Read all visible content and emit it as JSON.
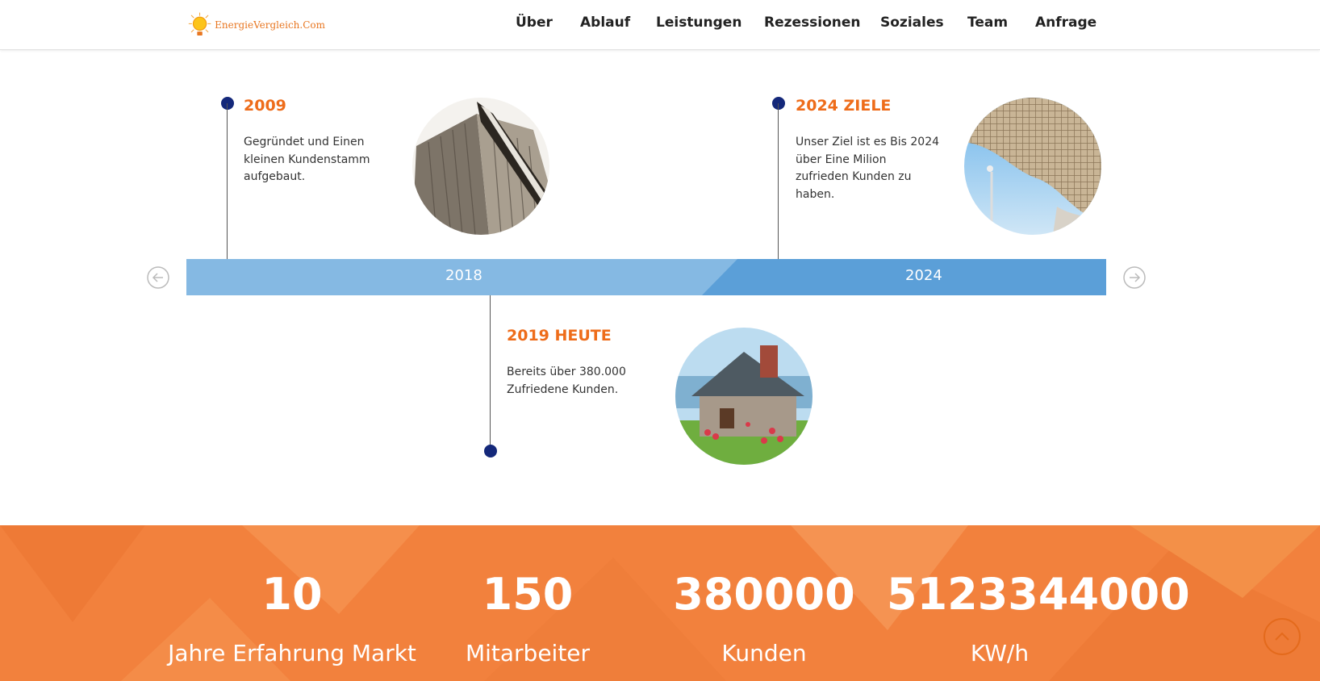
{
  "brand": {
    "logo_text": "EnergieVergleich.Com"
  },
  "nav": {
    "items": [
      {
        "label": "Über"
      },
      {
        "label": "Ablauf"
      },
      {
        "label": "Leistungen"
      },
      {
        "label": "Rezessionen"
      },
      {
        "label": "Soziales"
      },
      {
        "label": "Team"
      },
      {
        "label": "Anfrage"
      }
    ]
  },
  "timeline": {
    "events": [
      {
        "title": "2009",
        "text": "Gegründet und Einen kleinen Kundenstamm aufgebaut."
      },
      {
        "title": "2024 ZIELE",
        "text": "Unser Ziel ist es Bis 2024 über Eine Milion zufrieden Kunden zu haben."
      },
      {
        "title": "2019 HEUTE",
        "text": "Bereits über 380.000 Zufriedene Kunden."
      }
    ],
    "periods": [
      {
        "label": "2018"
      },
      {
        "label": "2024"
      }
    ]
  },
  "stats": [
    {
      "number": "10",
      "label": "Jahre Erfahrung Markt"
    },
    {
      "number": "150",
      "label": "Mitarbeiter"
    },
    {
      "number": "380000",
      "label": "Kunden"
    },
    {
      "number": "5123344000",
      "label": "KW/h"
    }
  ],
  "colors": {
    "accent": "#ee6c1a",
    "dot": "#14287a",
    "bar_light": "#85b9e3",
    "bar_dark": "#5b9fd8",
    "stats_bg": "#f2813d"
  },
  "icons": {
    "prev": "arrow-left-circle-icon",
    "next": "arrow-right-circle-icon",
    "to_top": "chevron-up-circle-icon",
    "logo": "sun-bulb-icon"
  }
}
